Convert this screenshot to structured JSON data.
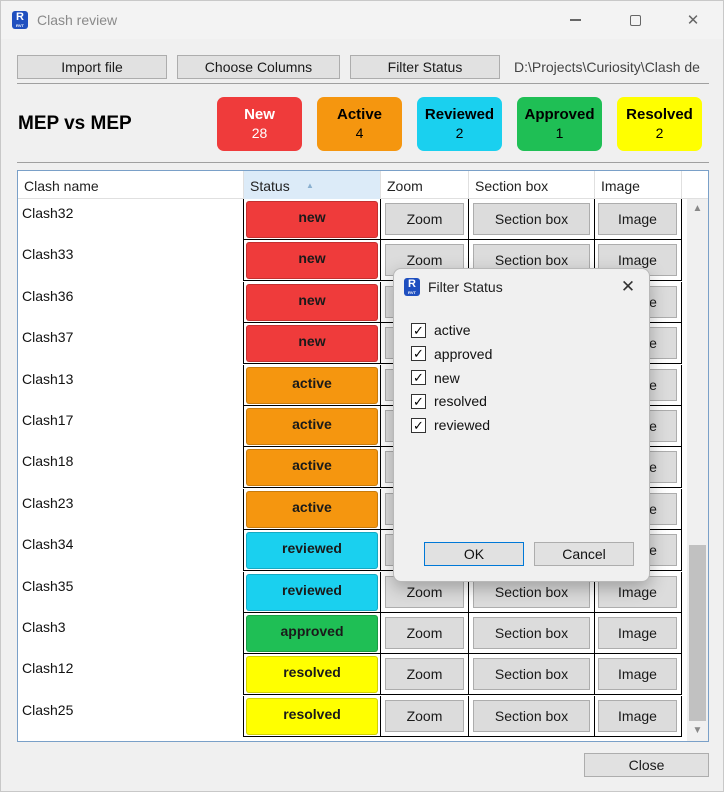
{
  "window": {
    "title": "Clash review",
    "app_icon": "revit-icon",
    "app_icon_text": "R",
    "app_icon_subtext": "RVT"
  },
  "toolbar": {
    "import_label": "Import file",
    "columns_label": "Choose Columns",
    "filter_label": "Filter Status",
    "path": "D:\\Projects\\Curiosity\\Clash de"
  },
  "summary": {
    "group_title": "MEP vs MEP",
    "badges": [
      {
        "label": "New",
        "count": "28",
        "color": "#ef3b3b",
        "text_color": "#ffffff"
      },
      {
        "label": "Active",
        "count": "4",
        "color": "#f5960f",
        "text_color": "#000000"
      },
      {
        "label": "Reviewed",
        "count": "2",
        "color": "#1ad0ef",
        "text_color": "#000000"
      },
      {
        "label": "Approved",
        "count": "1",
        "color": "#1fbf55",
        "text_color": "#000000"
      },
      {
        "label": "Resolved",
        "count": "2",
        "color": "#ffff00",
        "text_color": "#000000"
      }
    ]
  },
  "grid": {
    "columns": [
      "Clash name",
      "Status",
      "Zoom",
      "Section box",
      "Image"
    ],
    "sorted_column": "Status",
    "zoom_label": "Zoom",
    "section_label": "Section box",
    "image_label": "Image",
    "rows": [
      {
        "name": "Clash32",
        "status": "new",
        "color": "#ef3b3b"
      },
      {
        "name": "Clash33",
        "status": "new",
        "color": "#ef3b3b"
      },
      {
        "name": "Clash36",
        "status": "new",
        "color": "#ef3b3b"
      },
      {
        "name": "Clash37",
        "status": "new",
        "color": "#ef3b3b"
      },
      {
        "name": "Clash13",
        "status": "active",
        "color": "#f5960f"
      },
      {
        "name": "Clash17",
        "status": "active",
        "color": "#f5960f"
      },
      {
        "name": "Clash18",
        "status": "active",
        "color": "#f5960f"
      },
      {
        "name": "Clash23",
        "status": "active",
        "color": "#f5960f"
      },
      {
        "name": "Clash34",
        "status": "reviewed",
        "color": "#1ad0ef"
      },
      {
        "name": "Clash35",
        "status": "reviewed",
        "color": "#1ad0ef"
      },
      {
        "name": "Clash3",
        "status": "approved",
        "color": "#1fbf55"
      },
      {
        "name": "Clash12",
        "status": "resolved",
        "color": "#ffff00"
      },
      {
        "name": "Clash25",
        "status": "resolved",
        "color": "#ffff00"
      }
    ]
  },
  "dialog": {
    "title": "Filter Status",
    "options": [
      {
        "label": "active",
        "checked": true
      },
      {
        "label": "approved",
        "checked": true
      },
      {
        "label": "new",
        "checked": true
      },
      {
        "label": "resolved",
        "checked": true
      },
      {
        "label": "reviewed",
        "checked": true
      }
    ],
    "ok_label": "OK",
    "cancel_label": "Cancel"
  },
  "footer": {
    "close_label": "Close"
  }
}
